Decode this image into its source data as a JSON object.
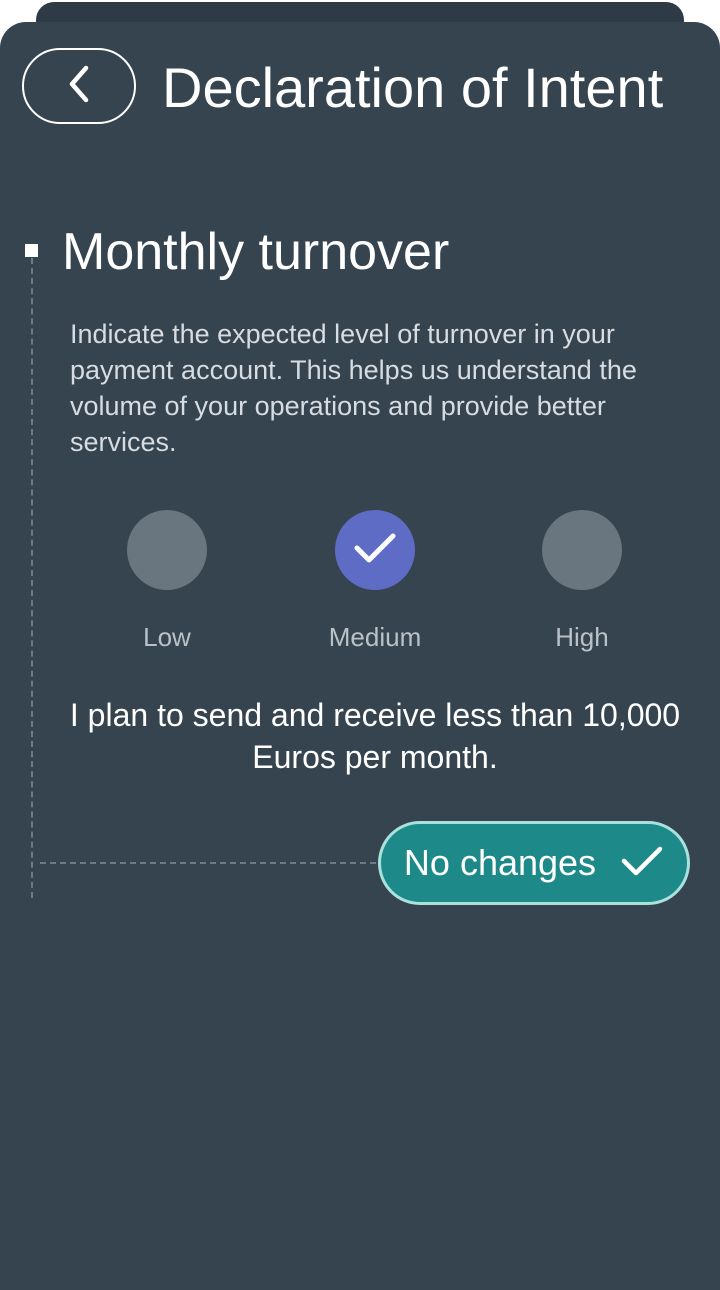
{
  "header": {
    "title": "Declaration of Intent",
    "back_icon": "chevron-left-icon"
  },
  "section": {
    "title": "Monthly turnover",
    "description": "Indicate the expected level of turnover in your payment account. This helps us understand the volume of your operations and provide better services."
  },
  "options": [
    {
      "label": "Low",
      "selected": false
    },
    {
      "label": "Medium",
      "selected": true
    },
    {
      "label": "High",
      "selected": false
    }
  ],
  "summary": "I plan to send and receive less than 10,000 Euros per month.",
  "confirm_button": {
    "label": "No changes",
    "icon": "check-icon"
  },
  "colors": {
    "background": "#36444f",
    "selected_option": "#5f6cc5",
    "unselected_option": "#69757f",
    "accent_button": "#1d8a89"
  }
}
